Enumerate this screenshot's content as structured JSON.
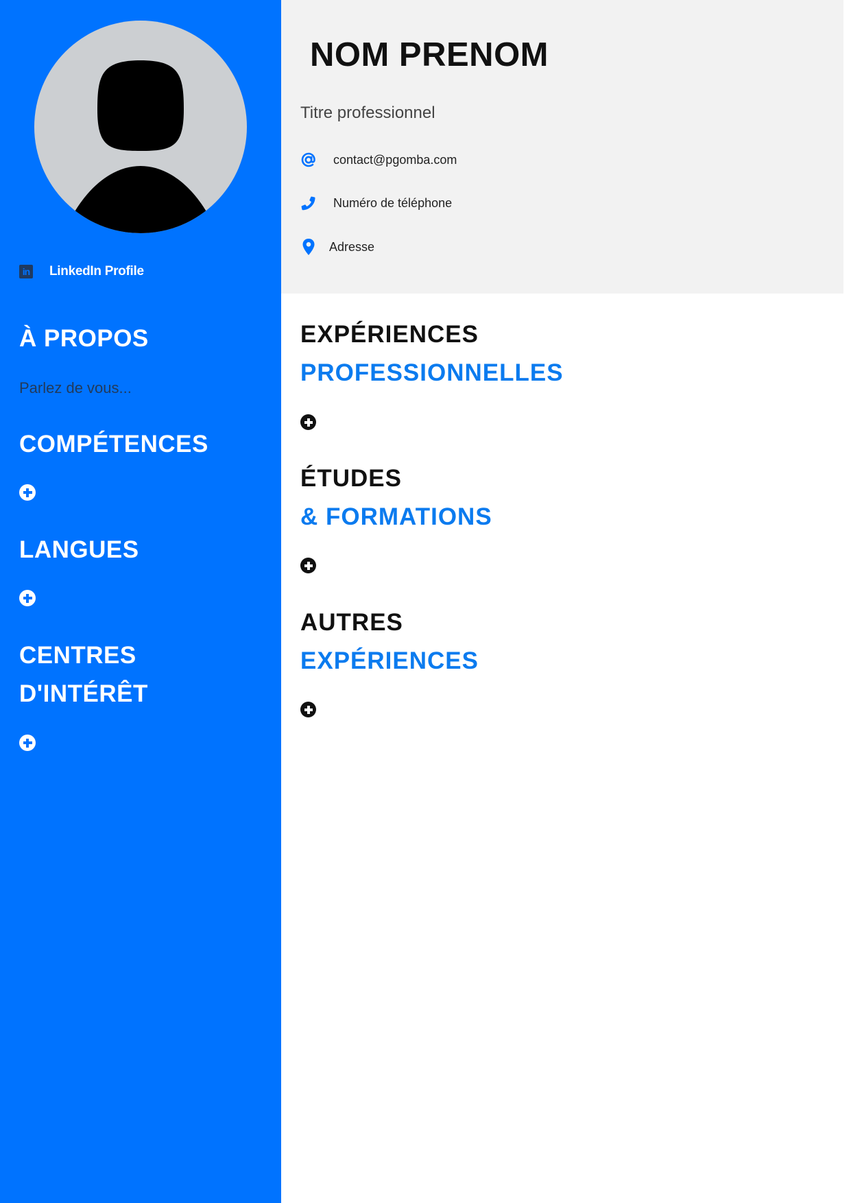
{
  "sidebar": {
    "avatar_icon": "user-silhouette-icon",
    "linkedin": {
      "icon": "linkedin-icon",
      "icon_text": "in",
      "label": "LinkedIn Profile"
    },
    "about": {
      "title": "À PROPOS",
      "text": "Parlez de vous..."
    },
    "skills": {
      "title": "COMPÉTENCES",
      "add_icon": "plus-circle-icon"
    },
    "languages": {
      "title": "LANGUES",
      "add_icon": "plus-circle-icon"
    },
    "interests": {
      "title_line1": "CENTRES",
      "title_line2": "D'INTÉRÊT",
      "add_icon": "plus-circle-icon"
    }
  },
  "header": {
    "name": "NOM PRENOM",
    "job_title": "Titre professionnel",
    "contacts": [
      {
        "icon": "at-icon",
        "text": "contact@pgomba.com"
      },
      {
        "icon": "phone-icon",
        "text": "Numéro de téléphone"
      },
      {
        "icon": "location-pin-icon",
        "text": "Adresse"
      }
    ]
  },
  "main": {
    "experience": {
      "title_dark": "EXPÉRIENCES",
      "title_blue": "PROFESSIONNELLES"
    },
    "education": {
      "title_dark": "ÉTUDES",
      "title_blue": "& FORMATIONS"
    },
    "other": {
      "title_dark": "AUTRES",
      "title_blue": "EXPÉRIENCES"
    }
  },
  "colors": {
    "sidebar_bg": "#0073ff",
    "accent_blue": "#0b7bef",
    "header_bg": "#f2f2f2",
    "avatar_bg": "#cccfd2"
  }
}
